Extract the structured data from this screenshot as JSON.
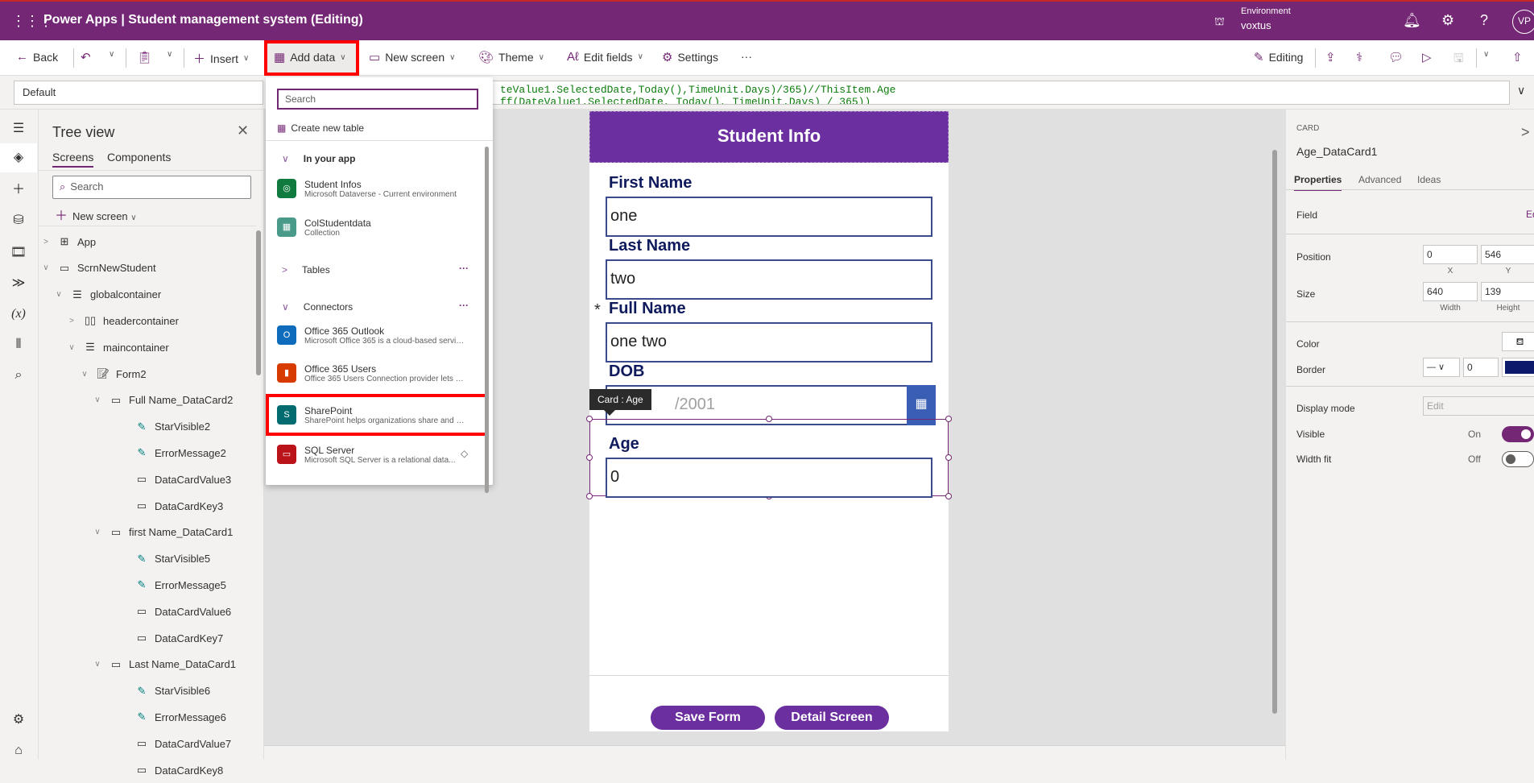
{
  "topbar": {
    "waffle_icon": "⋮⋮⋮",
    "title": "Power Apps  |  Student management system (Editing)",
    "environment_label": "Environment",
    "environment_name": "voxtus",
    "avatar_initials": "VP"
  },
  "toolbar": {
    "back": "Back",
    "insert": "Insert",
    "add_data": "Add data",
    "new_screen": "New screen",
    "theme": "Theme",
    "edit_fields": "Edit fields",
    "settings": "Settings",
    "more": "···",
    "editing": "Editing"
  },
  "formula_bar": {
    "property": "Default",
    "line1": "teValue1.SelectedDate,Today(),TimeUnit.Days)/365)//ThisItem.Age",
    "line2": "ff(DateValue1.SelectedDate, Today(), TimeUnit.Days) / 365))"
  },
  "tree_view": {
    "title": "Tree view",
    "tabs": [
      "Screens",
      "Components"
    ],
    "search_placeholder": "Search",
    "new_screen": "New screen",
    "nodes": [
      {
        "label": "App",
        "depth": 0,
        "expanded": false
      },
      {
        "label": "ScrnNewStudent",
        "depth": 0,
        "expanded": true
      },
      {
        "label": "globalcontainer",
        "depth": 1,
        "expanded": true
      },
      {
        "label": "headercontainer",
        "depth": 2,
        "expanded": false
      },
      {
        "label": "maincontainer",
        "depth": 2,
        "expanded": true
      },
      {
        "label": "Form2",
        "depth": 3,
        "expanded": true
      },
      {
        "label": "Full Name_DataCard2",
        "depth": 4,
        "expanded": true
      },
      {
        "label": "StarVisible2",
        "depth": 5
      },
      {
        "label": "ErrorMessage2",
        "depth": 5
      },
      {
        "label": "DataCardValue3",
        "depth": 5
      },
      {
        "label": "DataCardKey3",
        "depth": 5
      },
      {
        "label": "first Name_DataCard1",
        "depth": 4,
        "expanded": true
      },
      {
        "label": "StarVisible5",
        "depth": 5
      },
      {
        "label": "ErrorMessage5",
        "depth": 5
      },
      {
        "label": "DataCardValue6",
        "depth": 5
      },
      {
        "label": "DataCardKey7",
        "depth": 5
      },
      {
        "label": "Last Name_DataCard1",
        "depth": 4,
        "expanded": true
      },
      {
        "label": "StarVisible6",
        "depth": 5
      },
      {
        "label": "ErrorMessage6",
        "depth": 5
      },
      {
        "label": "DataCardValue7",
        "depth": 5
      },
      {
        "label": "DataCardKey8",
        "depth": 5
      }
    ]
  },
  "add_data_menu": {
    "search_placeholder": "Search",
    "create_new_table": "Create new table",
    "in_your_app": "In your app",
    "tables": "Tables",
    "connectors": "Connectors",
    "more": "···",
    "app_sources": [
      {
        "name": "Student Infos",
        "desc": "Microsoft Dataverse - Current environment",
        "color": "#0f7b3e"
      },
      {
        "name": "ColStudentdata",
        "desc": "Collection",
        "color": "#4a9a8a"
      }
    ],
    "connector_items": [
      {
        "name": "Office 365 Outlook",
        "desc": "Microsoft Office 365 is a cloud-based servic...",
        "color": "#0f6cbd"
      },
      {
        "name": "Office 365 Users",
        "desc": "Office 365 Users Connection provider lets y...",
        "color": "#d83b01"
      },
      {
        "name": "SharePoint",
        "desc": "SharePoint helps organizations share and c...",
        "color": "#036c70"
      },
      {
        "name": "SQL Server",
        "desc": "Microsoft SQL Server is a relational data...",
        "color": "#ba141a"
      }
    ]
  },
  "app_screen": {
    "header": "Student Info",
    "fields": [
      {
        "label": "First Name",
        "value": "one",
        "required": false
      },
      {
        "label": "Last Name",
        "value": "two",
        "required": false
      },
      {
        "label": "Full Name",
        "value": "one two",
        "required": true
      },
      {
        "label": "DOB",
        "value": "/2001",
        "required": false
      },
      {
        "label": "Age",
        "value": "0",
        "required": false
      }
    ],
    "required_mark": "*",
    "tooltip": "Card : Age",
    "save_button": "Save Form",
    "detail_button": "Detail Screen"
  },
  "properties": {
    "type": "CARD",
    "name": "Age_DataCard1",
    "tabs": [
      "Properties",
      "Advanced",
      "Ideas"
    ],
    "field_label": "Field",
    "field_edit": "Ed",
    "position_label": "Position",
    "position_x": "0",
    "position_y": "546",
    "x_label": "X",
    "y_label": "Y",
    "size_label": "Size",
    "width": "640",
    "height": "139",
    "width_label": "Width",
    "height_label": "Height",
    "color_label": "Color",
    "border_label": "Border",
    "border_width": "0",
    "border_color": "#0b1a6b",
    "display_mode_label": "Display mode",
    "display_mode_value": "Edit",
    "visible_label": "Visible",
    "visible_state": "On",
    "width_fit_label": "Width fit",
    "width_fit_state": "Off"
  },
  "colors": {
    "brand": "#742774",
    "app_header": "#6b2fa0",
    "highlight": "#ff0000"
  }
}
